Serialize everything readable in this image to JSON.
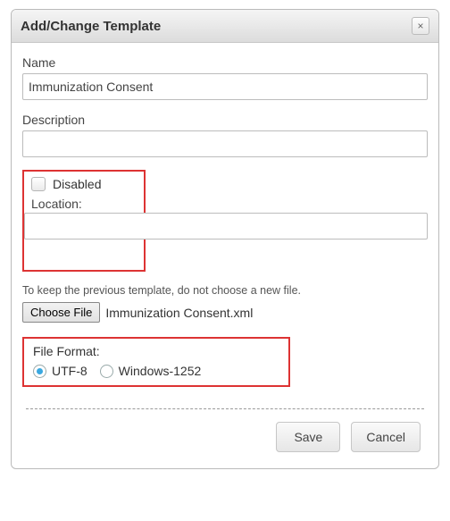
{
  "dialog": {
    "title": "Add/Change Template",
    "close_icon": "×"
  },
  "fields": {
    "name_label": "Name",
    "name_value": "Immunization Consent",
    "description_label": "Description",
    "description_value": "",
    "disabled_label": "Disabled",
    "location_label": "Location:",
    "location_value": ""
  },
  "file": {
    "hint": "To keep the previous template, do not choose a new file.",
    "choose_label": "Choose File",
    "filename": "Immunization Consent.xml"
  },
  "format": {
    "title": "File Format:",
    "options": [
      {
        "label": "UTF-8",
        "selected": true
      },
      {
        "label": "Windows-1252",
        "selected": false
      }
    ]
  },
  "buttons": {
    "save": "Save",
    "cancel": "Cancel"
  }
}
